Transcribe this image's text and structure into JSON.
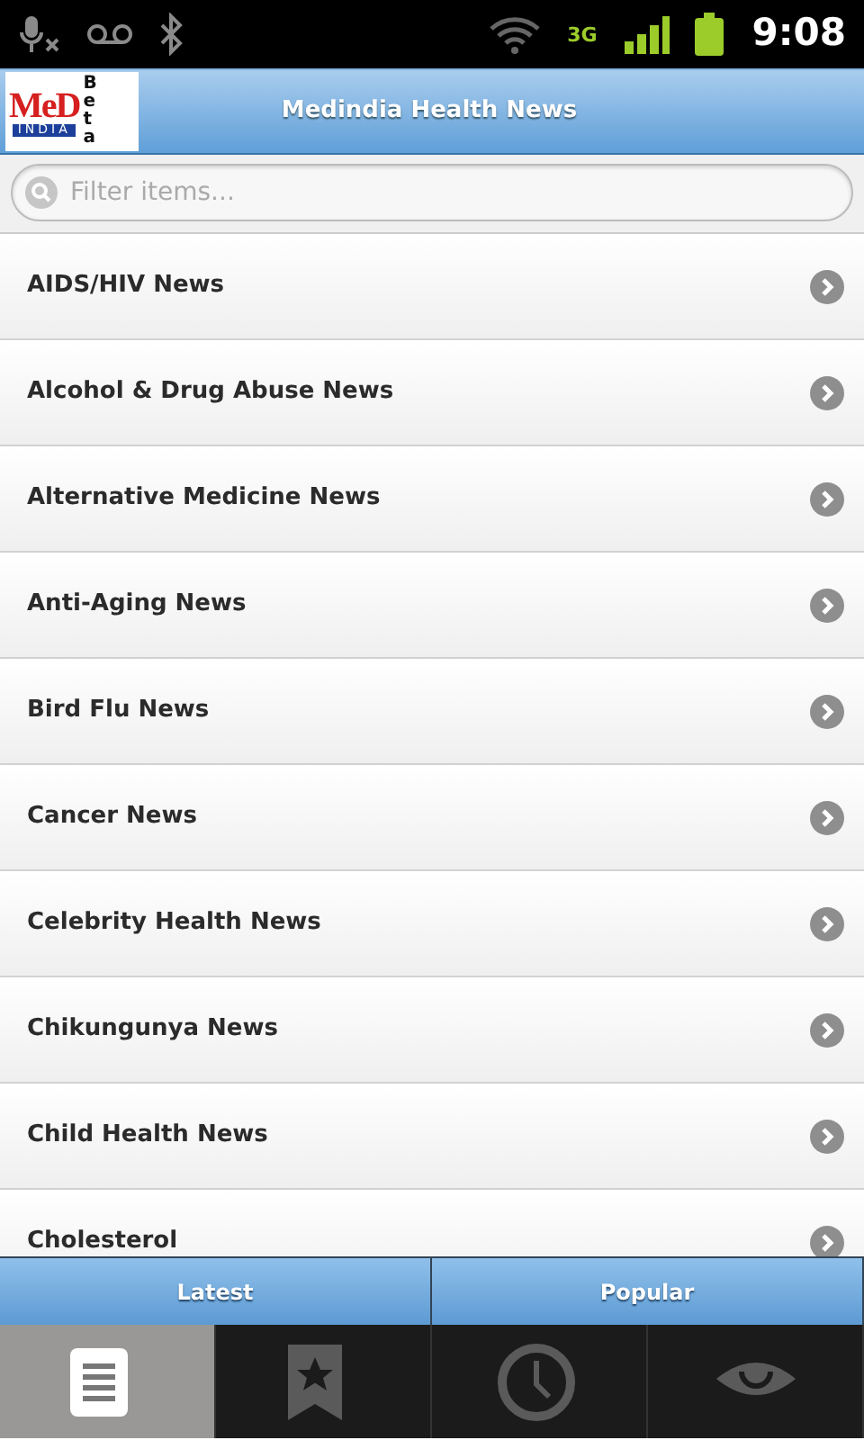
{
  "status_bar": {
    "network_type": "3G",
    "time": "9:08"
  },
  "header": {
    "logo": {
      "letters": "MeD",
      "subtitle": "INDIA",
      "badge": "Beta"
    },
    "title": "Medindia Health News"
  },
  "filter": {
    "placeholder": "Filter items..."
  },
  "items": [
    {
      "label": "AIDS/HIV News"
    },
    {
      "label": "Alcohol & Drug Abuse News"
    },
    {
      "label": "Alternative Medicine News"
    },
    {
      "label": "Anti-Aging News"
    },
    {
      "label": "Bird Flu News"
    },
    {
      "label": "Cancer News"
    },
    {
      "label": "Celebrity Health News"
    },
    {
      "label": "Chikungunya News"
    },
    {
      "label": "Child Health News"
    },
    {
      "label": "Cholesterol"
    }
  ],
  "segments": [
    {
      "label": "Latest"
    },
    {
      "label": "Popular"
    }
  ],
  "bottom_tabs": [
    {
      "kind": "list",
      "selected": true
    },
    {
      "kind": "bookmark",
      "selected": false
    },
    {
      "kind": "clock",
      "selected": false
    },
    {
      "kind": "eye",
      "selected": false
    }
  ]
}
